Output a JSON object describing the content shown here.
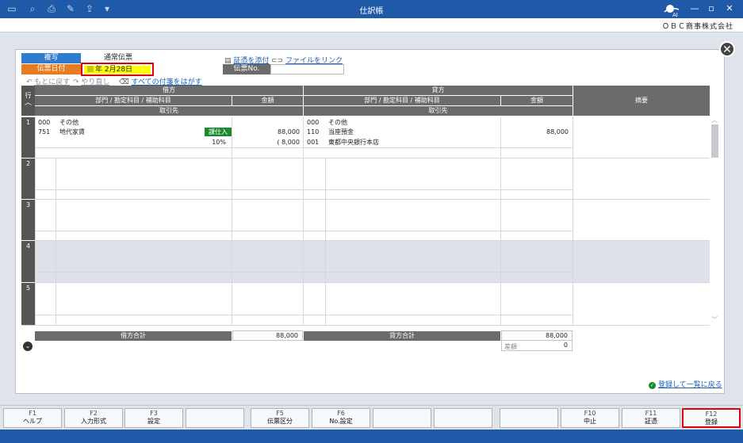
{
  "window": {
    "title": "仕訳帳",
    "company": "ＯＢＣ商事株式会社"
  },
  "labels": {
    "copy": "複写",
    "voucher_type": "通常伝票",
    "date_label": "伝票日付",
    "date_value": "年  2月28日",
    "attach": "証憑を添付",
    "link_file": "ファイルをリンク",
    "voucher_no": "伝票No.",
    "undo": "もとに戻す",
    "redo": "やり直し",
    "peel": "すべての付箋をはがす"
  },
  "grid": {
    "row_header": "行",
    "debit": "借方",
    "credit": "貸方",
    "account_cols": "部門 / 勘定科目 / 補助科目",
    "amount": "金額",
    "partner": "取引先",
    "memo": "摘要"
  },
  "entries": [
    {
      "row": "1",
      "debit": {
        "dept": "000",
        "dept_name": "その他",
        "acct": "751",
        "acct_name": "地代家賃",
        "tax_badge": "課仕入",
        "amount": "88,000",
        "rate": "10%",
        "tax_amt": "( 8,000"
      },
      "credit": {
        "dept": "000",
        "dept_name": "その他",
        "acct": "110",
        "acct_name": "当座預金",
        "amount": "88,000",
        "sub": "001",
        "sub_name": "東都中央銀行本店"
      }
    },
    {
      "row": "2"
    },
    {
      "row": "3"
    },
    {
      "row": "4"
    },
    {
      "row": "5"
    }
  ],
  "totals": {
    "debit_label": "借方合計",
    "debit_value": "88,000",
    "credit_label": "貸方合計",
    "credit_value": "88,000",
    "diff_label": "差額",
    "diff_value": "0"
  },
  "return_link": "登録して一覧に戻る",
  "fkeys": [
    {
      "key": "F1",
      "label": "ヘルプ"
    },
    {
      "key": "F2",
      "label": "入力形式"
    },
    {
      "key": "F3",
      "label": "設定"
    },
    {
      "key": "",
      "label": ""
    },
    {
      "key": "F5",
      "label": "伝票区分"
    },
    {
      "key": "F6",
      "label": "No.設定"
    },
    {
      "key": "",
      "label": ""
    },
    {
      "key": "",
      "label": ""
    },
    {
      "key": "",
      "label": ""
    },
    {
      "key": "F10",
      "label": "中止"
    },
    {
      "key": "F11",
      "label": "証憑"
    },
    {
      "key": "F12",
      "label": "登録"
    }
  ],
  "colors": {
    "titlebar": "#1e5aa8",
    "copy": "#2e7bd0",
    "date": "#e87c1e",
    "highlight": "#e00010",
    "badge": "#198a2e"
  }
}
